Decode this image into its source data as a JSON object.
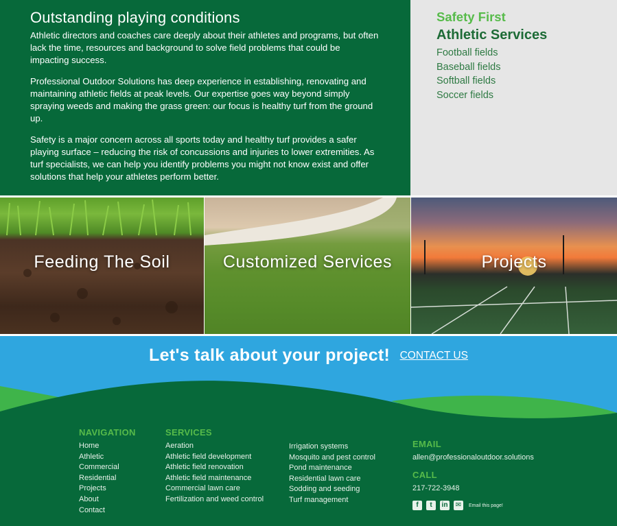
{
  "intro": {
    "heading": "Outstanding playing conditions",
    "paragraphs": [
      "Athletic directors and coaches care deeply about their athletes and programs, but often lack the time, resources and background to solve field problems that could be impacting success.",
      "Professional Outdoor Solutions has deep experience in establishing, renovating and maintaining athletic fields at peak levels. Our expertise goes way beyond simply spraying weeds and making the grass green: our focus is healthy turf from the ground up.",
      "Safety is a major concern across all sports today and healthy turf provides a safer playing surface – reducing the risk of concussions and injuries to lower extremities. As turf specialists, we can help you identify problems you might not know exist and offer solutions that help your athletes perform better."
    ]
  },
  "sidebar": {
    "safety": "Safety First",
    "title": "Athletic Services",
    "items": [
      "Football fields",
      "Baseball fields",
      "Softball fields",
      "Soccer fields"
    ]
  },
  "tiles": [
    {
      "label": "Feeding The Soil"
    },
    {
      "label": "Customized Services"
    },
    {
      "label": "Projects"
    }
  ],
  "cta": {
    "headline": "Let's talk about your project!",
    "contact_label": "CONTACT US"
  },
  "footer": {
    "navigation": {
      "title": "NAVIGATION",
      "items": [
        "Home",
        "Athletic",
        "Commercial",
        "Residential",
        "Projects",
        "About",
        "Contact"
      ]
    },
    "services": {
      "title": "SERVICES",
      "col1": [
        "Aeration",
        "Athletic field development",
        "Athletic field renovation",
        "Athletic field maintenance",
        "Commercial lawn care",
        "Fertilization and weed control"
      ],
      "col2": [
        "Irrigation systems",
        "Mosquito and pest control",
        "Pond maintenance",
        "Residential lawn care",
        "Sodding and seeding",
        "Turf management"
      ]
    },
    "email_title": "EMAIL",
    "email": "allen@professionaloutdoor.solutions",
    "call_title": "CALL",
    "phone": "217-722-3948",
    "email_page": "Email this page!",
    "social_icons": [
      "facebook-icon",
      "twitter-icon",
      "linkedin-icon",
      "envelope-icon"
    ]
  },
  "colors": {
    "dark_green": "#07693a",
    "accent_green": "#57bb4a",
    "sky_blue": "#2fa6df",
    "light_gray": "#e6e6e6"
  }
}
